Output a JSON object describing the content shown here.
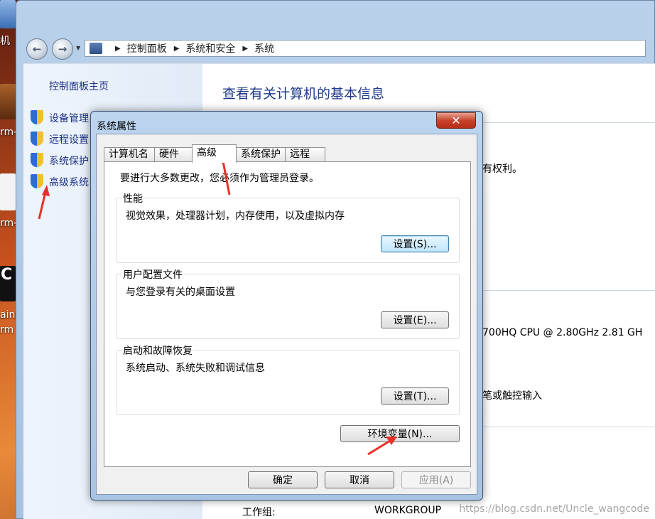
{
  "desktop": {
    "items": [
      "机",
      "rm-",
      "rm-",
      "ains",
      "rm"
    ]
  },
  "explorer": {
    "breadcrumb": [
      "控制面板",
      "系统和安全",
      "系统"
    ],
    "left_pane": {
      "home": "控制面板主页",
      "links": [
        "设备管理",
        "远程设置",
        "系统保护",
        "高级系统"
      ]
    },
    "main": {
      "title": "查看有关计算机的基本信息",
      "fragments": {
        "rights": "有权利。",
        "cpu": "700HQ CPU @ 2.80GHz   2.81 GH",
        "touch": "笔或触控输入",
        "workgroup_label": "工作组:",
        "workgroup_value": "WORKGROUP"
      }
    },
    "watermark": "https://blog.csdn.net/Uncle_wangcode"
  },
  "dialog": {
    "title": "系统属性",
    "tabs": [
      "计算机名",
      "硬件",
      "高级",
      "系统保护",
      "远程"
    ],
    "active_tab": "高级",
    "admin_note": "要进行大多数更改，您必须作为管理员登录。",
    "groups": [
      {
        "label": "性能",
        "desc": "视觉效果，处理器计划，内存使用，以及虚拟内存",
        "button": "设置(S)..."
      },
      {
        "label": "用户配置文件",
        "desc": "与您登录有关的桌面设置",
        "button": "设置(E)..."
      },
      {
        "label": "启动和故障恢复",
        "desc": "系统启动、系统失败和调试信息",
        "button": "设置(T)..."
      }
    ],
    "env_button": "环境变量(N)...",
    "ok": "确定",
    "cancel": "取消",
    "apply": "应用(A)"
  },
  "colors": {
    "link": "#1e3287",
    "title": "#1e3a8a",
    "arrow": "#e8302a"
  }
}
